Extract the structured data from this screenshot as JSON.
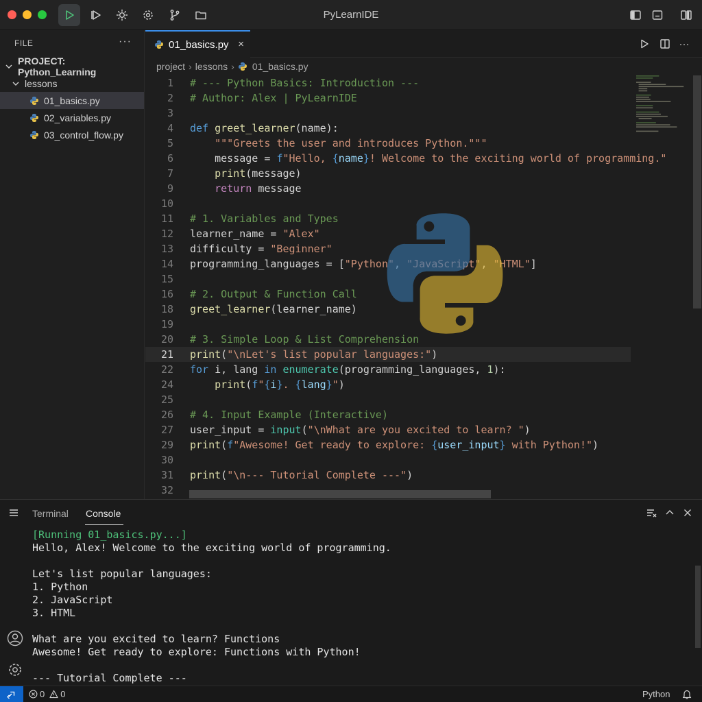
{
  "window": {
    "title": "PyLearnIDE"
  },
  "toolbar": {
    "buttons": [
      "run",
      "run-outline",
      "debug",
      "settings",
      "source-control",
      "folder"
    ],
    "right_buttons": [
      "toggle-sidebar",
      "toggle-panel",
      "layout"
    ]
  },
  "sidebar": {
    "header": "FILE",
    "more": "···",
    "project": "PROJECT: Python_Learning",
    "folder": "lessons",
    "files": [
      "01_basics.py",
      "02_variables.py",
      "03_control_flow.py"
    ],
    "selected_file": "01_basics.py"
  },
  "editor": {
    "tab": {
      "label": "01_basics.py",
      "close": "×"
    },
    "breadcrumb": [
      "project",
      "lessons",
      "01_basics.py"
    ],
    "active_line": "21",
    "lines": [
      {
        "n": "1",
        "text": "# --- Python Basics: Introduction ---"
      },
      {
        "n": "2",
        "text": "# Author: Alex | PyLearnIDE"
      },
      {
        "n": "3",
        "text": ""
      },
      {
        "n": "4",
        "text": "def greet_learner(name):"
      },
      {
        "n": "5",
        "text": "    \"\"\"Greets the user and introduces Python.\"\"\""
      },
      {
        "n": "6",
        "text": "    message = f\"Hello, {name}! Welcome to the exciting world of programming.\""
      },
      {
        "n": "7",
        "text": "    print(message)"
      },
      {
        "n": "9",
        "text": "    return message"
      },
      {
        "n": "10",
        "text": ""
      },
      {
        "n": "11",
        "text": "# 1. Variables and Types"
      },
      {
        "n": "12",
        "text": "learner_name = \"Alex\""
      },
      {
        "n": "13",
        "text": "difficulty = \"Beginner\""
      },
      {
        "n": "14",
        "text": "programming_languages = [\"Python\", \"JavaScript\", \"HTML\"]"
      },
      {
        "n": "15",
        "text": ""
      },
      {
        "n": "16",
        "text": "# 2. Output & Function Call"
      },
      {
        "n": "18",
        "text": "greet_learner(learner_name)"
      },
      {
        "n": "19",
        "text": ""
      },
      {
        "n": "20",
        "text": "# 3. Simple Loop & List Comprehension"
      },
      {
        "n": "21",
        "text": "print(\"\\nLet's list popular languages:\")"
      },
      {
        "n": "22",
        "text": "for i, lang in enumerate(programming_languages, 1):"
      },
      {
        "n": "24",
        "text": "    print(f\"{i}. {lang}\")"
      },
      {
        "n": "25",
        "text": ""
      },
      {
        "n": "26",
        "text": "# 4. Input Example (Interactive)"
      },
      {
        "n": "27",
        "text": "user_input = input(\"\\nWhat are you excited to learn? \")"
      },
      {
        "n": "29",
        "text": "print(f\"Awesome! Get ready to explore: {user_input} with Python!\")"
      },
      {
        "n": "30",
        "text": ""
      },
      {
        "n": "31",
        "text": "print(\"\\n--- Tutorial Complete ---\")"
      },
      {
        "n": "32",
        "text": ""
      }
    ]
  },
  "panel": {
    "tabs": [
      "Terminal",
      "Console"
    ],
    "active_tab": "Console",
    "output": [
      "[Running 01_basics.py...]",
      "Hello, Alex! Welcome to the exciting world of programming.",
      "",
      "Let's list popular languages:",
      "1. Python",
      "2. JavaScript",
      "3. HTML",
      "",
      "What are you excited to learn? Functions",
      "Awesome! Get ready to explore: Functions with Python!",
      "",
      "--- Tutorial Complete ---"
    ]
  },
  "statusbar": {
    "errors": "0",
    "warnings": "0",
    "language": "Python"
  },
  "colors": {
    "accent": "#3b8eea",
    "comment": "#6a9955",
    "keyword": "#569cd6",
    "string": "#ce9178",
    "function": "#dcdcaa",
    "console_running": "#4ec27a",
    "remote_indicator": "#0e63c8"
  }
}
